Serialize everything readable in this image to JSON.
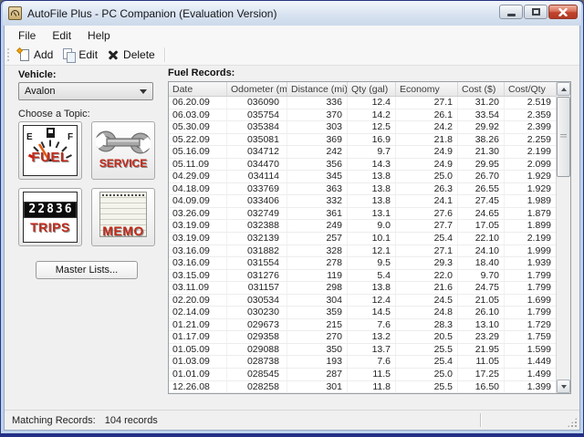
{
  "window": {
    "title": "AutoFile Plus - PC Companion (Evaluation Version)"
  },
  "menu": {
    "items": [
      "File",
      "Edit",
      "Help"
    ]
  },
  "toolbar": {
    "buttons": [
      {
        "label": "Add",
        "icon": "add-new-icon"
      },
      {
        "label": "Edit",
        "icon": "edit-copy-icon"
      },
      {
        "label": "Delete",
        "icon": "delete-x-icon"
      }
    ]
  },
  "sidebar": {
    "vehicle_label": "Vehicle:",
    "vehicle_selected": "Avalon",
    "topic_label": "Choose a Topic:",
    "topics": [
      {
        "label": "FUEL",
        "icon": "fuel-gauge-icon"
      },
      {
        "label": "SERVICE",
        "icon": "wrench-icon"
      },
      {
        "label": "TRIPS",
        "icon": "odometer-icon",
        "odometer_reading": "22836"
      },
      {
        "label": "MEMO",
        "icon": "memo-pad-icon"
      }
    ],
    "master_lists_label": "Master Lists..."
  },
  "records": {
    "title": "Fuel Records:",
    "columns": [
      "Date",
      "Odometer (mi)",
      "Distance (mi)",
      "Qty (gal)",
      "Economy",
      "Cost ($)",
      "Cost/Qty"
    ],
    "rows": [
      [
        "06.20.09",
        "036090",
        "336",
        "12.4",
        "27.1",
        "31.20",
        "2.519"
      ],
      [
        "06.03.09",
        "035754",
        "370",
        "14.2",
        "26.1",
        "33.54",
        "2.359"
      ],
      [
        "05.30.09",
        "035384",
        "303",
        "12.5",
        "24.2",
        "29.92",
        "2.399"
      ],
      [
        "05.22.09",
        "035081",
        "369",
        "16.9",
        "21.8",
        "38.26",
        "2.259"
      ],
      [
        "05.16.09",
        "034712",
        "242",
        "9.7",
        "24.9",
        "21.30",
        "2.199"
      ],
      [
        "05.11.09",
        "034470",
        "356",
        "14.3",
        "24.9",
        "29.95",
        "2.099"
      ],
      [
        "04.29.09",
        "034114",
        "345",
        "13.8",
        "25.0",
        "26.70",
        "1.929"
      ],
      [
        "04.18.09",
        "033769",
        "363",
        "13.8",
        "26.3",
        "26.55",
        "1.929"
      ],
      [
        "04.09.09",
        "033406",
        "332",
        "13.8",
        "24.1",
        "27.45",
        "1.989"
      ],
      [
        "03.26.09",
        "032749",
        "361",
        "13.1",
        "27.6",
        "24.65",
        "1.879"
      ],
      [
        "03.19.09",
        "032388",
        "249",
        "9.0",
        "27.7",
        "17.05",
        "1.899"
      ],
      [
        "03.19.09",
        "032139",
        "257",
        "10.1",
        "25.4",
        "22.10",
        "2.199"
      ],
      [
        "03.16.09",
        "031882",
        "328",
        "12.1",
        "27.1",
        "24.10",
        "1.999"
      ],
      [
        "03.16.09",
        "031554",
        "278",
        "9.5",
        "29.3",
        "18.40",
        "1.939"
      ],
      [
        "03.15.09",
        "031276",
        "119",
        "5.4",
        "22.0",
        "9.70",
        "1.799"
      ],
      [
        "03.11.09",
        "031157",
        "298",
        "13.8",
        "21.6",
        "24.75",
        "1.799"
      ],
      [
        "02.20.09",
        "030534",
        "304",
        "12.4",
        "24.5",
        "21.05",
        "1.699"
      ],
      [
        "02.14.09",
        "030230",
        "359",
        "14.5",
        "24.8",
        "26.10",
        "1.799"
      ],
      [
        "01.21.09",
        "029673",
        "215",
        "7.6",
        "28.3",
        "13.10",
        "1.729"
      ],
      [
        "01.17.09",
        "029358",
        "270",
        "13.2",
        "20.5",
        "23.29",
        "1.759"
      ],
      [
        "01.05.09",
        "029088",
        "350",
        "13.7",
        "25.5",
        "21.95",
        "1.599"
      ],
      [
        "01.03.09",
        "028738",
        "193",
        "7.6",
        "25.4",
        "11.05",
        "1.449"
      ],
      [
        "01.01.09",
        "028545",
        "287",
        "11.5",
        "25.0",
        "17.25",
        "1.499"
      ],
      [
        "12.26.08",
        "028258",
        "301",
        "11.8",
        "25.5",
        "16.50",
        "1.399"
      ]
    ]
  },
  "statusbar": {
    "label": "Matching Records:",
    "value": "104 records"
  },
  "colors": {
    "frame_blue": "#bdd3ec",
    "frame_navy": "#222f85",
    "close_red": "#c0442e",
    "topic_text_red": "#c22a1b",
    "content_bg": "#f0f0f0"
  }
}
